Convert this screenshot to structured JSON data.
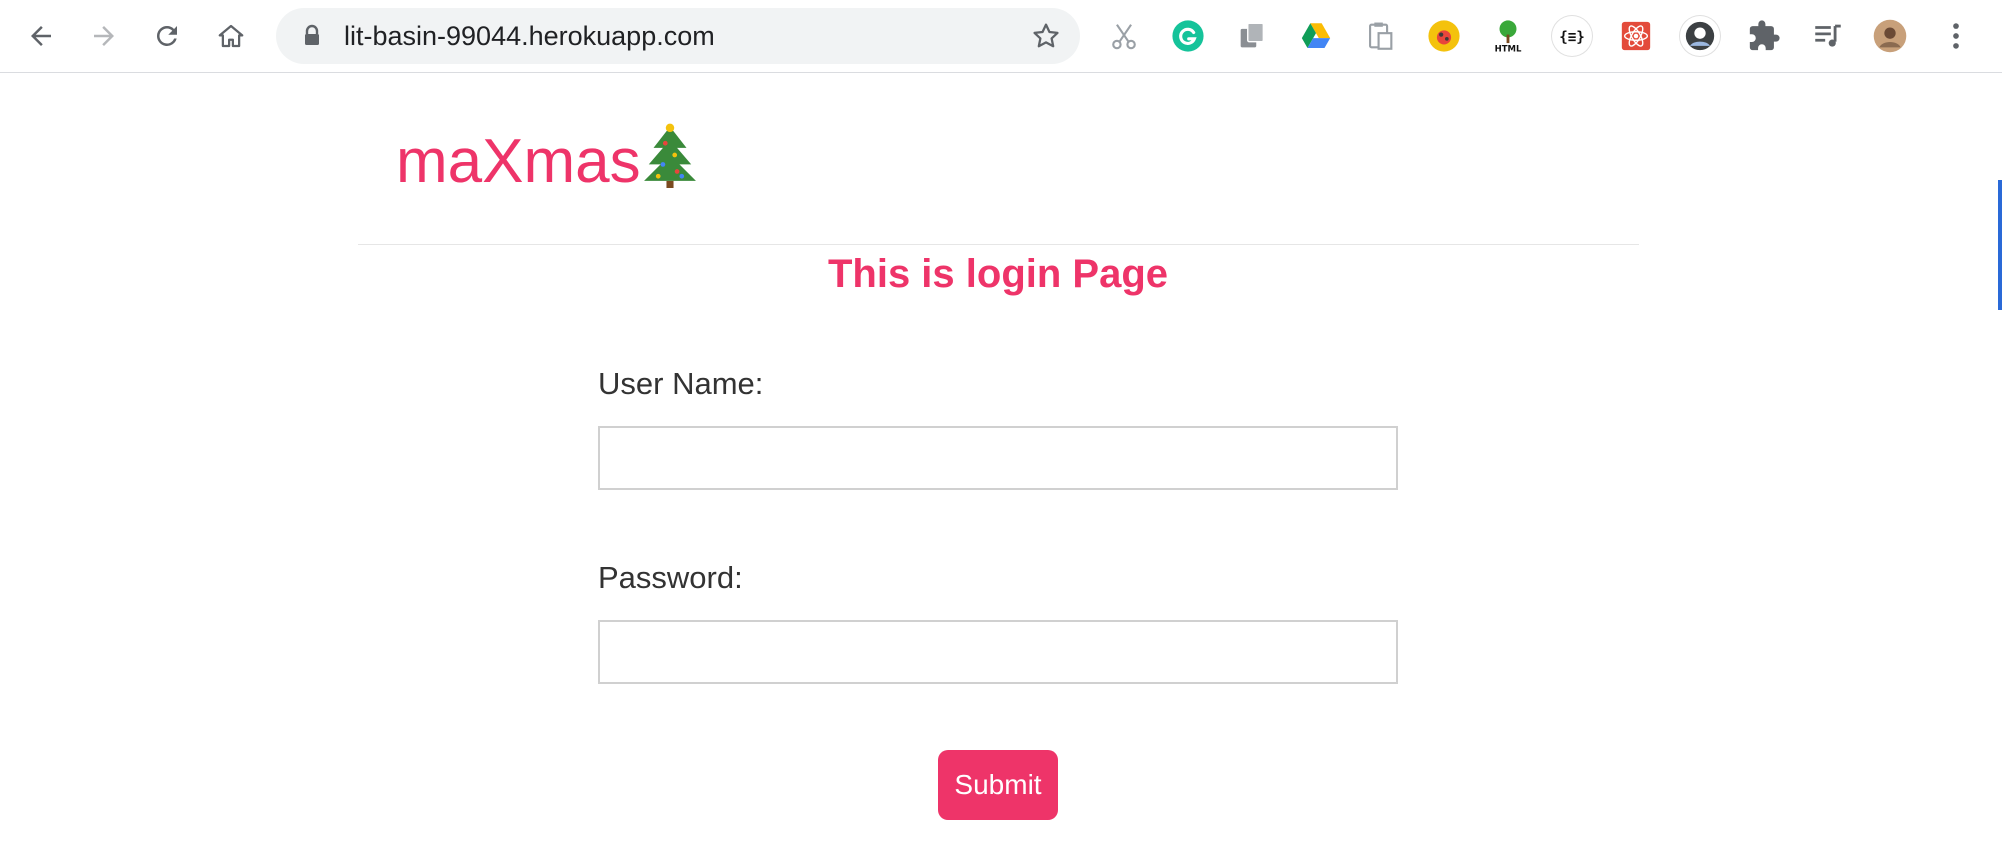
{
  "browser": {
    "url": "lit-basin-99044.herokuapp.com",
    "nav": {
      "back_icon": "arrow-left-icon",
      "forward_icon": "arrow-right-icon",
      "reload_icon": "reload-icon",
      "home_icon": "home-icon"
    },
    "extensions": [
      "scissors-icon",
      "grammarly-icon",
      "copy-docs-icon",
      "google-drive-icon",
      "clipboard-icon",
      "colorful-bug-icon",
      "html-tree-icon",
      "json-formatter-icon",
      "react-devtools-icon",
      "profile-ext-icon",
      "puzzle-icon",
      "media-playlist-icon",
      "user-avatar-icon",
      "kebab-menu-icon"
    ]
  },
  "page": {
    "brand": "maXmas",
    "heading": "This is login Page",
    "form": {
      "username_label": "User Name:",
      "username_value": "",
      "password_label": "Password:",
      "password_value": "",
      "submit_label": "Submit"
    }
  },
  "colors": {
    "accent": "#ee3469",
    "text": "#333333",
    "omnibox_bg": "#f1f3f4"
  }
}
